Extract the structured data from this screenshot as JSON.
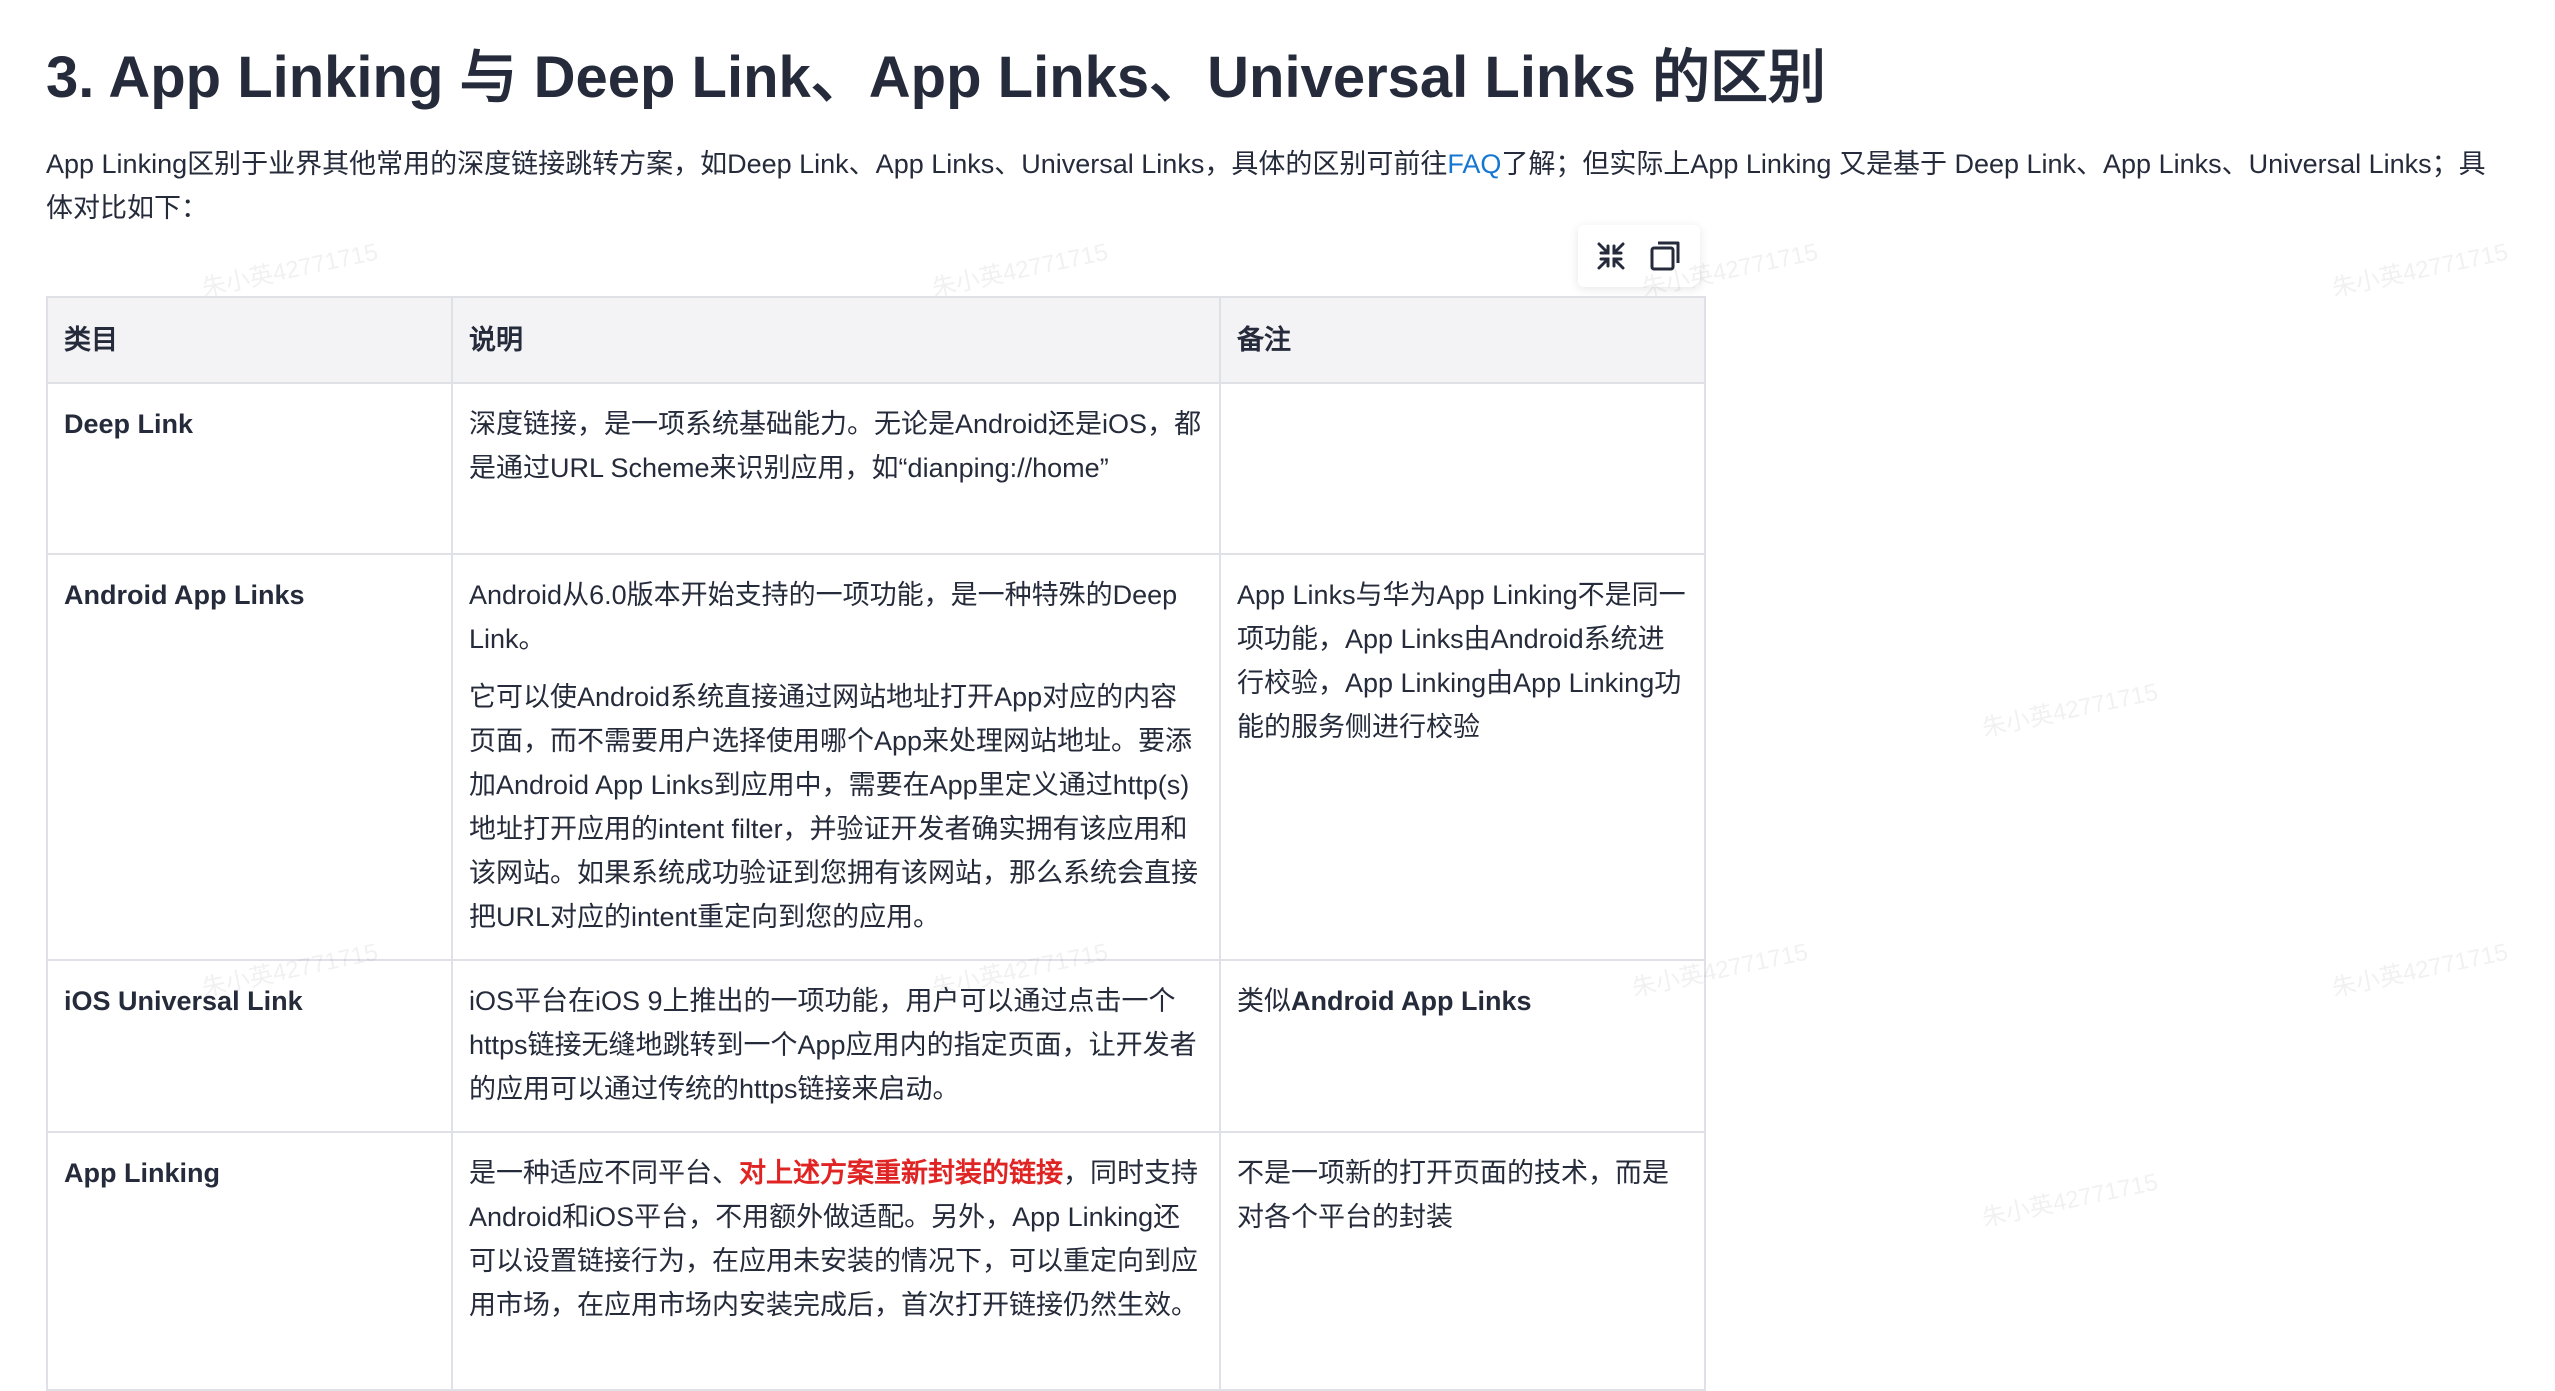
{
  "heading": "3. App Linking 与 Deep Link、App Links、Universal Links 的区别",
  "intro": {
    "before_link": "App Linking区别于业界其他常用的深度链接跳转方案，如Deep Link、App Links、Universal Links，具体的区别可前往",
    "link_text": "FAQ",
    "after_link": "了解；但实际上App Linking 又是基于 Deep Link、App Links、Universal Links；具体对比如下："
  },
  "toolbar": {
    "fullscreen_icon": "fullscreen-icon",
    "copy_icon": "copy-icon"
  },
  "table": {
    "headers": [
      "类目",
      "说明",
      "备注"
    ],
    "rows": [
      {
        "category": "Deep Link",
        "description": [
          "深度链接，是一项系统基础能力。无论是Android还是iOS，都是通过URL Scheme来识别应用，如“dianping://home”"
        ],
        "remark": ""
      },
      {
        "category": "Android App Links",
        "description": [
          "Android从6.0版本开始支持的一项功能，是一种特殊的Deep Link。",
          "它可以使Android系统直接通过网站地址打开App对应的内容页面，而不需要用户选择使用哪个App来处理网站地址。要添加Android App Links到应用中，需要在App里定义通过http(s)地址打开应用的intent filter，并验证开发者确实拥有该应用和该网站。如果系统成功验证到您拥有该网站，那么系统会直接把URL对应的intent重定向到您的应用。"
        ],
        "remark": "App Links与华为App Linking不是同一项功能，App Links由Android系统进行校验，App Linking由App Linking功能的服务侧进行校验"
      },
      {
        "category": "iOS Universal Link",
        "description": [
          "iOS平台在iOS 9上推出的一项功能，用户可以通过点击一个https链接无缝地跳转到一个App应用内的指定页面，让开发者的应用可以通过传统的https链接来启动。"
        ],
        "remark_prefix": "类似",
        "remark_bold": "Android App Links"
      },
      {
        "category": "App Linking",
        "description_prefix": "是一种适应不同平台、",
        "description_highlight": "对上述方案重新封装的链接",
        "description_suffix": "，同时支持Android和iOS平台，不用额外做适配。另外，App Linking还可以设置链接行为，在应用未安装的情况下，可以重定向到应用市场，在应用市场内安装完成后，首次打开链接仍然生效。",
        "remark": "不是一项新的打开页面的技术，而是对各个平台的封装"
      }
    ]
  },
  "watermark": "朱小英42771715",
  "colors": {
    "text": "#252b3a",
    "link": "#1677d2",
    "highlight": "#e02424",
    "header_bg": "#f3f3f5",
    "border": "#dfe1e6"
  }
}
